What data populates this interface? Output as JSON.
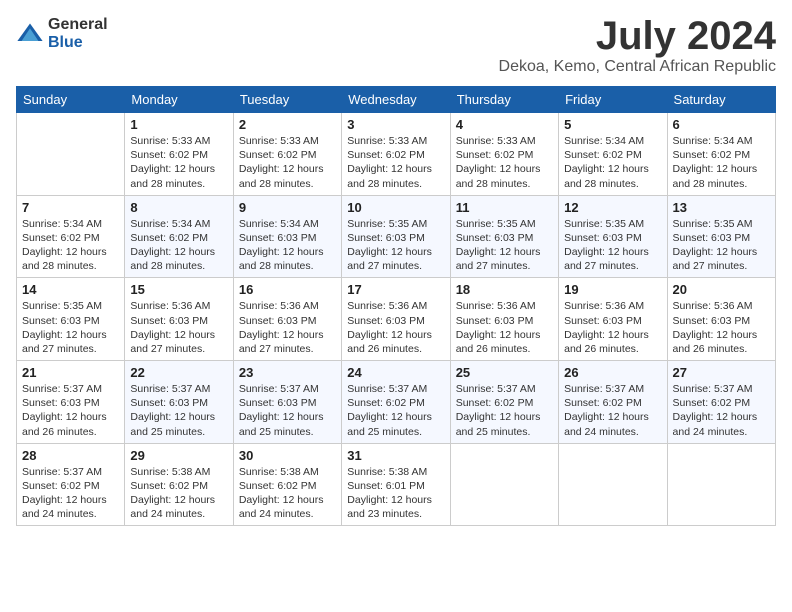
{
  "logo": {
    "general": "General",
    "blue": "Blue"
  },
  "header": {
    "month": "July 2024",
    "location": "Dekoa, Kemo, Central African Republic"
  },
  "weekdays": [
    "Sunday",
    "Monday",
    "Tuesday",
    "Wednesday",
    "Thursday",
    "Friday",
    "Saturday"
  ],
  "weeks": [
    [
      {
        "day": "",
        "info": ""
      },
      {
        "day": "1",
        "info": "Sunrise: 5:33 AM\nSunset: 6:02 PM\nDaylight: 12 hours\nand 28 minutes."
      },
      {
        "day": "2",
        "info": "Sunrise: 5:33 AM\nSunset: 6:02 PM\nDaylight: 12 hours\nand 28 minutes."
      },
      {
        "day": "3",
        "info": "Sunrise: 5:33 AM\nSunset: 6:02 PM\nDaylight: 12 hours\nand 28 minutes."
      },
      {
        "day": "4",
        "info": "Sunrise: 5:33 AM\nSunset: 6:02 PM\nDaylight: 12 hours\nand 28 minutes."
      },
      {
        "day": "5",
        "info": "Sunrise: 5:34 AM\nSunset: 6:02 PM\nDaylight: 12 hours\nand 28 minutes."
      },
      {
        "day": "6",
        "info": "Sunrise: 5:34 AM\nSunset: 6:02 PM\nDaylight: 12 hours\nand 28 minutes."
      }
    ],
    [
      {
        "day": "7",
        "info": "Sunrise: 5:34 AM\nSunset: 6:02 PM\nDaylight: 12 hours\nand 28 minutes."
      },
      {
        "day": "8",
        "info": "Sunrise: 5:34 AM\nSunset: 6:02 PM\nDaylight: 12 hours\nand 28 minutes."
      },
      {
        "day": "9",
        "info": "Sunrise: 5:34 AM\nSunset: 6:03 PM\nDaylight: 12 hours\nand 28 minutes."
      },
      {
        "day": "10",
        "info": "Sunrise: 5:35 AM\nSunset: 6:03 PM\nDaylight: 12 hours\nand 27 minutes."
      },
      {
        "day": "11",
        "info": "Sunrise: 5:35 AM\nSunset: 6:03 PM\nDaylight: 12 hours\nand 27 minutes."
      },
      {
        "day": "12",
        "info": "Sunrise: 5:35 AM\nSunset: 6:03 PM\nDaylight: 12 hours\nand 27 minutes."
      },
      {
        "day": "13",
        "info": "Sunrise: 5:35 AM\nSunset: 6:03 PM\nDaylight: 12 hours\nand 27 minutes."
      }
    ],
    [
      {
        "day": "14",
        "info": "Sunrise: 5:35 AM\nSunset: 6:03 PM\nDaylight: 12 hours\nand 27 minutes."
      },
      {
        "day": "15",
        "info": "Sunrise: 5:36 AM\nSunset: 6:03 PM\nDaylight: 12 hours\nand 27 minutes."
      },
      {
        "day": "16",
        "info": "Sunrise: 5:36 AM\nSunset: 6:03 PM\nDaylight: 12 hours\nand 27 minutes."
      },
      {
        "day": "17",
        "info": "Sunrise: 5:36 AM\nSunset: 6:03 PM\nDaylight: 12 hours\nand 26 minutes."
      },
      {
        "day": "18",
        "info": "Sunrise: 5:36 AM\nSunset: 6:03 PM\nDaylight: 12 hours\nand 26 minutes."
      },
      {
        "day": "19",
        "info": "Sunrise: 5:36 AM\nSunset: 6:03 PM\nDaylight: 12 hours\nand 26 minutes."
      },
      {
        "day": "20",
        "info": "Sunrise: 5:36 AM\nSunset: 6:03 PM\nDaylight: 12 hours\nand 26 minutes."
      }
    ],
    [
      {
        "day": "21",
        "info": "Sunrise: 5:37 AM\nSunset: 6:03 PM\nDaylight: 12 hours\nand 26 minutes."
      },
      {
        "day": "22",
        "info": "Sunrise: 5:37 AM\nSunset: 6:03 PM\nDaylight: 12 hours\nand 25 minutes."
      },
      {
        "day": "23",
        "info": "Sunrise: 5:37 AM\nSunset: 6:03 PM\nDaylight: 12 hours\nand 25 minutes."
      },
      {
        "day": "24",
        "info": "Sunrise: 5:37 AM\nSunset: 6:02 PM\nDaylight: 12 hours\nand 25 minutes."
      },
      {
        "day": "25",
        "info": "Sunrise: 5:37 AM\nSunset: 6:02 PM\nDaylight: 12 hours\nand 25 minutes."
      },
      {
        "day": "26",
        "info": "Sunrise: 5:37 AM\nSunset: 6:02 PM\nDaylight: 12 hours\nand 24 minutes."
      },
      {
        "day": "27",
        "info": "Sunrise: 5:37 AM\nSunset: 6:02 PM\nDaylight: 12 hours\nand 24 minutes."
      }
    ],
    [
      {
        "day": "28",
        "info": "Sunrise: 5:37 AM\nSunset: 6:02 PM\nDaylight: 12 hours\nand 24 minutes."
      },
      {
        "day": "29",
        "info": "Sunrise: 5:38 AM\nSunset: 6:02 PM\nDaylight: 12 hours\nand 24 minutes."
      },
      {
        "day": "30",
        "info": "Sunrise: 5:38 AM\nSunset: 6:02 PM\nDaylight: 12 hours\nand 24 minutes."
      },
      {
        "day": "31",
        "info": "Sunrise: 5:38 AM\nSunset: 6:01 PM\nDaylight: 12 hours\nand 23 minutes."
      },
      {
        "day": "",
        "info": ""
      },
      {
        "day": "",
        "info": ""
      },
      {
        "day": "",
        "info": ""
      }
    ]
  ]
}
